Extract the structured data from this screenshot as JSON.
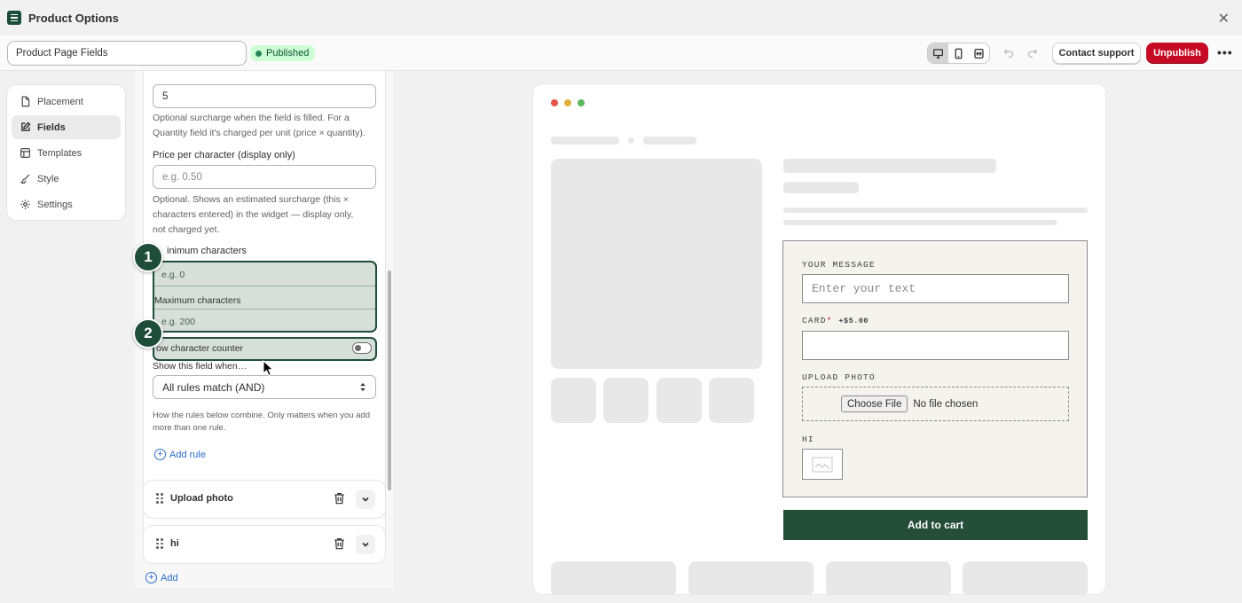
{
  "app": {
    "title": "Product Options",
    "icon": "app-logo-icon",
    "close_icon": "close-icon"
  },
  "toolbar": {
    "name_value": "Product Page Fields",
    "status": "Published",
    "devices": [
      "desktop-icon",
      "mobile-icon",
      "fullscreen-icon"
    ],
    "active_device": "desktop-icon",
    "contact_support": "Contact support",
    "unpublish": "Unpublish",
    "more": "•••"
  },
  "nav": {
    "items": [
      {
        "label": "Placement",
        "icon": "page-icon",
        "active": false
      },
      {
        "label": "Fields",
        "icon": "edit-icon",
        "active": true
      },
      {
        "label": "Templates",
        "icon": "template-icon",
        "active": false
      },
      {
        "label": "Style",
        "icon": "paint-brush-icon",
        "active": false
      },
      {
        "label": "Settings",
        "icon": "gear-icon",
        "active": false
      }
    ]
  },
  "form": {
    "surcharge_value": "5",
    "surcharge_help": "Optional surcharge when the field is filled. For a Quantity field it's charged per unit (price × quantity).",
    "surcharge_help_1": "Optional surcharge when the field is filled. For a",
    "surcharge_help_2": "Quantity field it's charged per unit (price × quantity).",
    "price_per_char_label": "Price per character (display only)",
    "price_per_char_placeholder": "e.g. 0.50",
    "price_per_char_help_1": "Optional. Shows an estimated surcharge (this ×",
    "price_per_char_help_2": "characters entered) in the widget — display only,",
    "price_per_char_help_3": "not charged yet.",
    "min_label": "inimum characters",
    "min_placeholder": "e.g. 0",
    "max_label": "Maximum characters",
    "max_placeholder": "e.g. 200",
    "counter_label": "ow character counter",
    "counter_on": false,
    "show_when_label": "Show this field when…",
    "rules_select": "All rules match (AND)",
    "rules_help_1": "How the rules below combine. Only matters when you add",
    "rules_help_2": "more than one rule.",
    "add_rule": "Add rule",
    "fields": [
      "Upload photo",
      "hi"
    ],
    "add": "Add"
  },
  "annotations": {
    "step1": "1",
    "step2": "2"
  },
  "preview": {
    "message_label": "YOUR MESSAGE",
    "message_placeholder": "Enter your text",
    "card_label": "CARD",
    "card_required": "*",
    "card_price": "+$5.00",
    "upload_label": "UPLOAD PHOTO",
    "choose_file": "Choose File",
    "no_file": "No file chosen",
    "hi_label": "HI",
    "add_to_cart": "Add to cart"
  },
  "colors": {
    "brand": "#1e4d39",
    "danger": "#c70a24",
    "success_bg": "#cdfed4",
    "link": "#2c6ecb",
    "cart_button": "#244d3a"
  }
}
